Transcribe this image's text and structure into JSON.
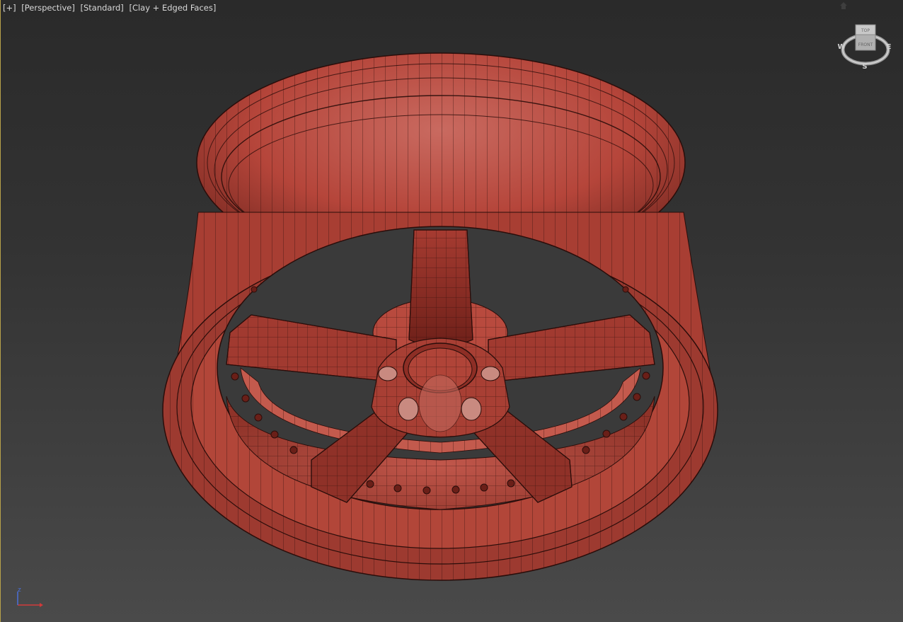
{
  "viewport": {
    "labels": {
      "plus": "[+]",
      "view": "[Perspective]",
      "shading_style": "[Standard]",
      "display_mode": "[Clay + Edged Faces]"
    }
  },
  "viewcube": {
    "faces": {
      "top": "TOP",
      "front": "FRONT"
    },
    "compass": {
      "west": "W",
      "east": "E",
      "south": "S"
    }
  },
  "axis_gizmo": {
    "z": "z",
    "icon": "axis-tripod-icon"
  },
  "scene": {
    "object": "wheel-rim-model",
    "material_color": "#b5453a",
    "wire_color": "#2a0d0a"
  }
}
